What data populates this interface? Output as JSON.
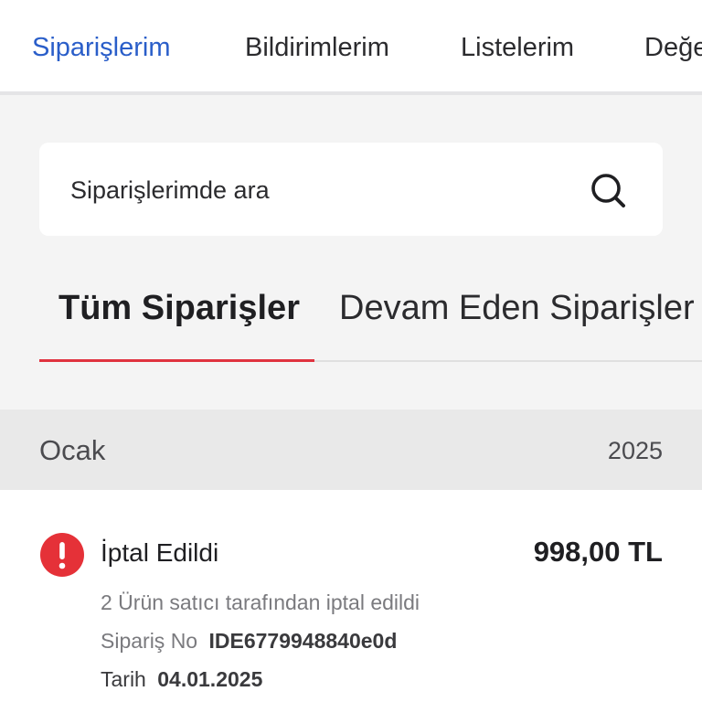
{
  "top_tabs": [
    {
      "label": "Siparişlerim",
      "active": true
    },
    {
      "label": "Bildirimlerim",
      "active": false
    },
    {
      "label": "Listelerim",
      "active": false
    },
    {
      "label": "Değe",
      "active": false
    }
  ],
  "search": {
    "placeholder": "Siparişlerimde ara",
    "icon": "search-icon"
  },
  "order_tabs": [
    {
      "label": "Tüm Siparişler",
      "active": true
    },
    {
      "label": "Devam Eden Siparişler",
      "active": false
    }
  ],
  "month_group": {
    "month": "Ocak",
    "year": "2025"
  },
  "order": {
    "status_icon": "alert-icon",
    "status": "İptal Edildi",
    "price": "998,00 TL",
    "note": "2 Ürün satıcı tarafından iptal edildi",
    "order_no_label": "Sipariş No",
    "order_no": "IDE6779948840e0d",
    "date_label": "Tarih",
    "date": "04.01.2025"
  },
  "colors": {
    "accent": "#2a5ec9",
    "active_tab_underline": "#e0323f",
    "cancelled_status": "#e53138"
  }
}
